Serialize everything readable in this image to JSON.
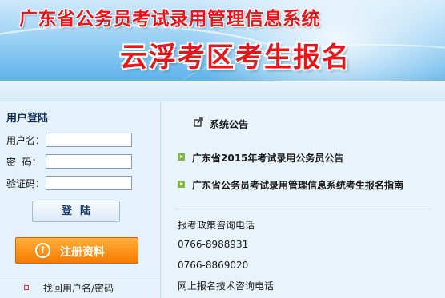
{
  "header": {
    "system_title": "广东省公务员考试录用管理信息系统",
    "district_title": "云浮考区考生报名"
  },
  "login": {
    "title": "用户登陆",
    "username_label": "用户名：",
    "password_label": "密  码：",
    "captcha_label": "验证码：",
    "username_value": "",
    "password_value": "",
    "captcha_value": "",
    "login_button": "登陆",
    "register_button": "注册资料",
    "register_icon": "upload-arrow-icon",
    "find_account_link": "找回用户名/密码"
  },
  "notices": {
    "heading": "系统公告",
    "heading_icon": "external-link-icon",
    "items": [
      "广东省2015年考试录用公务员公告",
      "广东省公务员考试录用管理信息系统考生报名指南"
    ]
  },
  "contacts": {
    "policy_label": "报考政策咨询电话",
    "phone_1": "0766-8988931",
    "phone_2": "0766-8869020",
    "tech_label": "网上报名技术咨询电话"
  },
  "colors": {
    "title_red": "#e8151b",
    "register_orange": "#f77a00",
    "panel_blue": "#e6f2fb",
    "bullet_green": "#7fb93e"
  }
}
